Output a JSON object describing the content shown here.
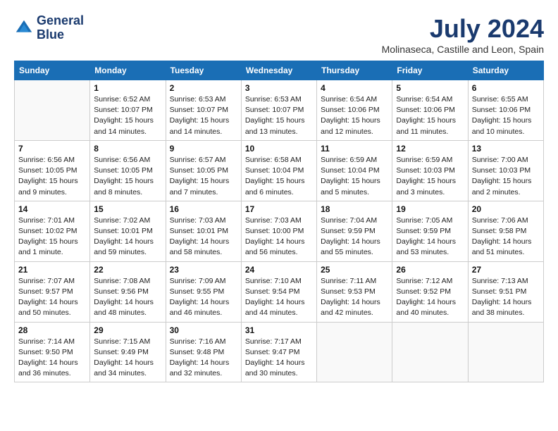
{
  "header": {
    "logo_line1": "General",
    "logo_line2": "Blue",
    "month": "July 2024",
    "location": "Molinaseca, Castille and Leon, Spain"
  },
  "weekdays": [
    "Sunday",
    "Monday",
    "Tuesday",
    "Wednesday",
    "Thursday",
    "Friday",
    "Saturday"
  ],
  "weeks": [
    [
      {
        "day": "",
        "info": ""
      },
      {
        "day": "1",
        "info": "Sunrise: 6:52 AM\nSunset: 10:07 PM\nDaylight: 15 hours\nand 14 minutes."
      },
      {
        "day": "2",
        "info": "Sunrise: 6:53 AM\nSunset: 10:07 PM\nDaylight: 15 hours\nand 14 minutes."
      },
      {
        "day": "3",
        "info": "Sunrise: 6:53 AM\nSunset: 10:07 PM\nDaylight: 15 hours\nand 13 minutes."
      },
      {
        "day": "4",
        "info": "Sunrise: 6:54 AM\nSunset: 10:06 PM\nDaylight: 15 hours\nand 12 minutes."
      },
      {
        "day": "5",
        "info": "Sunrise: 6:54 AM\nSunset: 10:06 PM\nDaylight: 15 hours\nand 11 minutes."
      },
      {
        "day": "6",
        "info": "Sunrise: 6:55 AM\nSunset: 10:06 PM\nDaylight: 15 hours\nand 10 minutes."
      }
    ],
    [
      {
        "day": "7",
        "info": "Sunrise: 6:56 AM\nSunset: 10:05 PM\nDaylight: 15 hours\nand 9 minutes."
      },
      {
        "day": "8",
        "info": "Sunrise: 6:56 AM\nSunset: 10:05 PM\nDaylight: 15 hours\nand 8 minutes."
      },
      {
        "day": "9",
        "info": "Sunrise: 6:57 AM\nSunset: 10:05 PM\nDaylight: 15 hours\nand 7 minutes."
      },
      {
        "day": "10",
        "info": "Sunrise: 6:58 AM\nSunset: 10:04 PM\nDaylight: 15 hours\nand 6 minutes."
      },
      {
        "day": "11",
        "info": "Sunrise: 6:59 AM\nSunset: 10:04 PM\nDaylight: 15 hours\nand 5 minutes."
      },
      {
        "day": "12",
        "info": "Sunrise: 6:59 AM\nSunset: 10:03 PM\nDaylight: 15 hours\nand 3 minutes."
      },
      {
        "day": "13",
        "info": "Sunrise: 7:00 AM\nSunset: 10:03 PM\nDaylight: 15 hours\nand 2 minutes."
      }
    ],
    [
      {
        "day": "14",
        "info": "Sunrise: 7:01 AM\nSunset: 10:02 PM\nDaylight: 15 hours\nand 1 minute."
      },
      {
        "day": "15",
        "info": "Sunrise: 7:02 AM\nSunset: 10:01 PM\nDaylight: 14 hours\nand 59 minutes."
      },
      {
        "day": "16",
        "info": "Sunrise: 7:03 AM\nSunset: 10:01 PM\nDaylight: 14 hours\nand 58 minutes."
      },
      {
        "day": "17",
        "info": "Sunrise: 7:03 AM\nSunset: 10:00 PM\nDaylight: 14 hours\nand 56 minutes."
      },
      {
        "day": "18",
        "info": "Sunrise: 7:04 AM\nSunset: 9:59 PM\nDaylight: 14 hours\nand 55 minutes."
      },
      {
        "day": "19",
        "info": "Sunrise: 7:05 AM\nSunset: 9:59 PM\nDaylight: 14 hours\nand 53 minutes."
      },
      {
        "day": "20",
        "info": "Sunrise: 7:06 AM\nSunset: 9:58 PM\nDaylight: 14 hours\nand 51 minutes."
      }
    ],
    [
      {
        "day": "21",
        "info": "Sunrise: 7:07 AM\nSunset: 9:57 PM\nDaylight: 14 hours\nand 50 minutes."
      },
      {
        "day": "22",
        "info": "Sunrise: 7:08 AM\nSunset: 9:56 PM\nDaylight: 14 hours\nand 48 minutes."
      },
      {
        "day": "23",
        "info": "Sunrise: 7:09 AM\nSunset: 9:55 PM\nDaylight: 14 hours\nand 46 minutes."
      },
      {
        "day": "24",
        "info": "Sunrise: 7:10 AM\nSunset: 9:54 PM\nDaylight: 14 hours\nand 44 minutes."
      },
      {
        "day": "25",
        "info": "Sunrise: 7:11 AM\nSunset: 9:53 PM\nDaylight: 14 hours\nand 42 minutes."
      },
      {
        "day": "26",
        "info": "Sunrise: 7:12 AM\nSunset: 9:52 PM\nDaylight: 14 hours\nand 40 minutes."
      },
      {
        "day": "27",
        "info": "Sunrise: 7:13 AM\nSunset: 9:51 PM\nDaylight: 14 hours\nand 38 minutes."
      }
    ],
    [
      {
        "day": "28",
        "info": "Sunrise: 7:14 AM\nSunset: 9:50 PM\nDaylight: 14 hours\nand 36 minutes."
      },
      {
        "day": "29",
        "info": "Sunrise: 7:15 AM\nSunset: 9:49 PM\nDaylight: 14 hours\nand 34 minutes."
      },
      {
        "day": "30",
        "info": "Sunrise: 7:16 AM\nSunset: 9:48 PM\nDaylight: 14 hours\nand 32 minutes."
      },
      {
        "day": "31",
        "info": "Sunrise: 7:17 AM\nSunset: 9:47 PM\nDaylight: 14 hours\nand 30 minutes."
      },
      {
        "day": "",
        "info": ""
      },
      {
        "day": "",
        "info": ""
      },
      {
        "day": "",
        "info": ""
      }
    ]
  ]
}
